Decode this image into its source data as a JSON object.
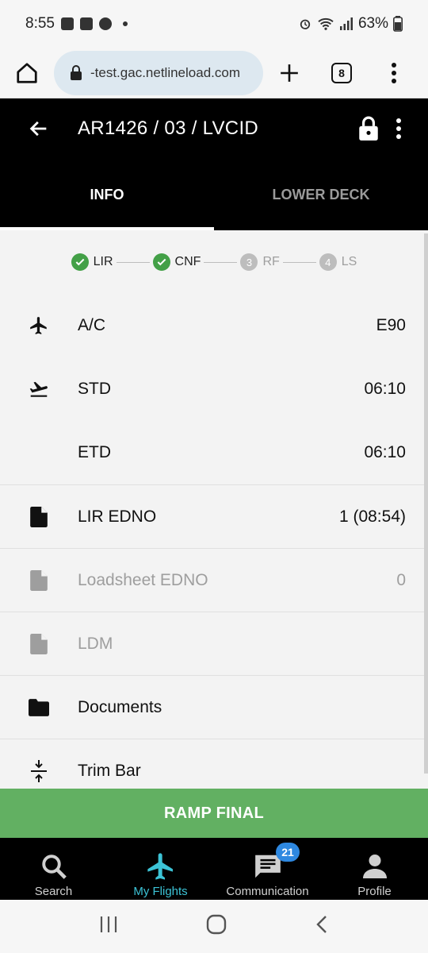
{
  "status": {
    "time": "8:55",
    "battery": "63%"
  },
  "browser": {
    "url": "-test.gac.netlineload.com",
    "tab_count": "8"
  },
  "appbar": {
    "title": "AR1426 / 03 / LVCID"
  },
  "tabs": [
    {
      "label": "INFO",
      "active": true
    },
    {
      "label": "LOWER DECK",
      "active": false
    }
  ],
  "stepper": [
    {
      "label": "LIR",
      "done": true
    },
    {
      "label": "CNF",
      "done": true
    },
    {
      "label": "RF",
      "num": "3",
      "done": false
    },
    {
      "label": "LS",
      "num": "4",
      "done": false
    }
  ],
  "rows": [
    {
      "icon": "airplane-icon",
      "label": "A/C",
      "value": "E90"
    },
    {
      "icon": "departure-icon",
      "label": "STD",
      "value": "06:10"
    },
    {
      "icon": "",
      "label": "ETD",
      "value": "06:10"
    },
    {
      "icon": "document-icon",
      "label": "LIR EDNO",
      "value": "1 (08:54)"
    },
    {
      "icon": "document-icon",
      "label": "Loadsheet EDNO",
      "value": "0"
    },
    {
      "icon": "document-icon",
      "label": "LDM",
      "value": ""
    },
    {
      "icon": "folder-icon",
      "label": "Documents",
      "value": ""
    },
    {
      "icon": "trim-icon",
      "label": "Trim Bar",
      "value": ""
    }
  ],
  "ramp_button": "RAMP FINAL",
  "bottom_nav": [
    {
      "label": "Search",
      "icon": "search-icon"
    },
    {
      "label": "My Flights",
      "icon": "airplane-icon",
      "active": true
    },
    {
      "label": "Communication",
      "icon": "chat-icon",
      "badge": "21"
    },
    {
      "label": "Profile",
      "icon": "person-icon"
    }
  ],
  "colors": {
    "accent": "#3cc3d6",
    "ramp_button": "#62b062",
    "step_done": "#43a047",
    "badge": "#2e88e0"
  }
}
